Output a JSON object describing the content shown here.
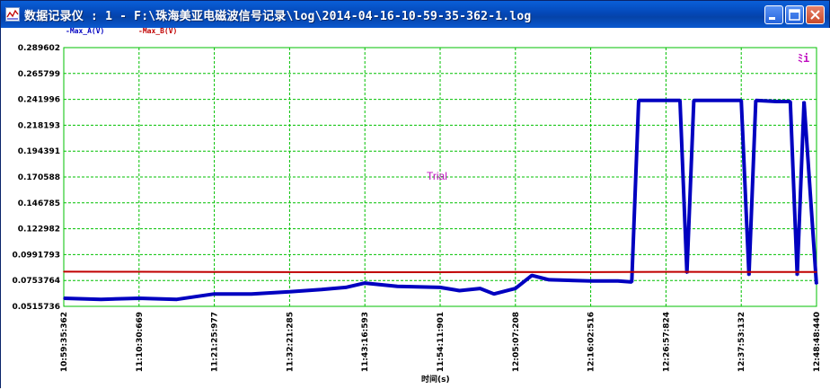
{
  "window": {
    "title": "数据记录仪 : 1 - F:\\珠海美亚电磁波信号记录\\log\\2014-04-16-10-59-35-362-1.log",
    "icon": "chart-app-icon"
  },
  "legend": {
    "series_a": "Max_A(V)",
    "series_b": "Max_B(V)"
  },
  "watermark": "Trial",
  "corner_mark": "ﾐi",
  "colors": {
    "series_a": "#0000C0",
    "series_b": "#C00000",
    "grid": "#00C000",
    "watermark": "#C010C0"
  },
  "chart_data": {
    "type": "line",
    "xlabel": "时间(s)",
    "ylabel": "",
    "title": "",
    "grid": true,
    "legend_position": "top-left",
    "y_ticks": [
      "0.289602",
      "0.265799",
      "0.241996",
      "0.218193",
      "0.194391",
      "0.170588",
      "0.146785",
      "0.122982",
      "0.0991793",
      "0.0753764",
      "0.0515736"
    ],
    "ylim": [
      0.0515736,
      0.289602
    ],
    "x_ticks": [
      "10:59:35:362",
      "11:10:30:669",
      "11:21:25:977",
      "11:32:21:285",
      "11:43:16:593",
      "11:54:11:901",
      "12:05:07:208",
      "12:16:02:516",
      "12:26:57:824",
      "12:37:53:132",
      "12:48:48:440"
    ],
    "xlim": [
      "10:59:35:362",
      "12:48:48:440"
    ],
    "series": [
      {
        "name": "Max_A(V)",
        "color": "#0000C0",
        "points": [
          [
            "10:59:35",
            0.059
          ],
          [
            "11:05:00",
            0.058
          ],
          [
            "11:10:30",
            0.059
          ],
          [
            "11:16:00",
            0.058
          ],
          [
            "11:21:25",
            0.063
          ],
          [
            "11:26:50",
            0.063
          ],
          [
            "11:32:21",
            0.065
          ],
          [
            "11:37:00",
            0.067
          ],
          [
            "11:40:30",
            0.069
          ],
          [
            "11:43:16",
            0.073
          ],
          [
            "11:48:00",
            0.07
          ],
          [
            "11:54:11",
            0.069
          ],
          [
            "11:57:00",
            0.066
          ],
          [
            "12:00:00",
            0.068
          ],
          [
            "12:02:00",
            0.063
          ],
          [
            "12:05:07",
            0.068
          ],
          [
            "12:07:30",
            0.08
          ],
          [
            "12:10:00",
            0.076
          ],
          [
            "12:16:02",
            0.075
          ],
          [
            "12:20:00",
            0.075
          ],
          [
            "12:22:00",
            0.074
          ],
          [
            "12:23:00",
            0.241
          ],
          [
            "12:26:57",
            0.241
          ],
          [
            "12:29:00",
            0.241
          ],
          [
            "12:30:00",
            0.082
          ],
          [
            "12:31:00",
            0.241
          ],
          [
            "12:35:00",
            0.241
          ],
          [
            "12:37:53",
            0.241
          ],
          [
            "12:39:00",
            0.08
          ],
          [
            "12:40:00",
            0.241
          ],
          [
            "12:43:00",
            0.24
          ],
          [
            "12:45:00",
            0.24
          ],
          [
            "12:46:00",
            0.08
          ],
          [
            "12:47:00",
            0.24
          ],
          [
            "12:48:48",
            0.072
          ]
        ]
      },
      {
        "name": "Max_B(V)",
        "color": "#C00000",
        "points": [
          [
            "10:59:35",
            0.0835
          ],
          [
            "11:10:30",
            0.0834
          ],
          [
            "11:21:25",
            0.0832
          ],
          [
            "11:32:21",
            0.0831
          ],
          [
            "11:43:16",
            0.083
          ],
          [
            "11:54:11",
            0.083
          ],
          [
            "12:05:07",
            0.0832
          ],
          [
            "12:16:02",
            0.0831
          ],
          [
            "12:26:57",
            0.0833
          ],
          [
            "12:37:53",
            0.0832
          ],
          [
            "12:48:48",
            0.0832
          ]
        ]
      }
    ]
  }
}
